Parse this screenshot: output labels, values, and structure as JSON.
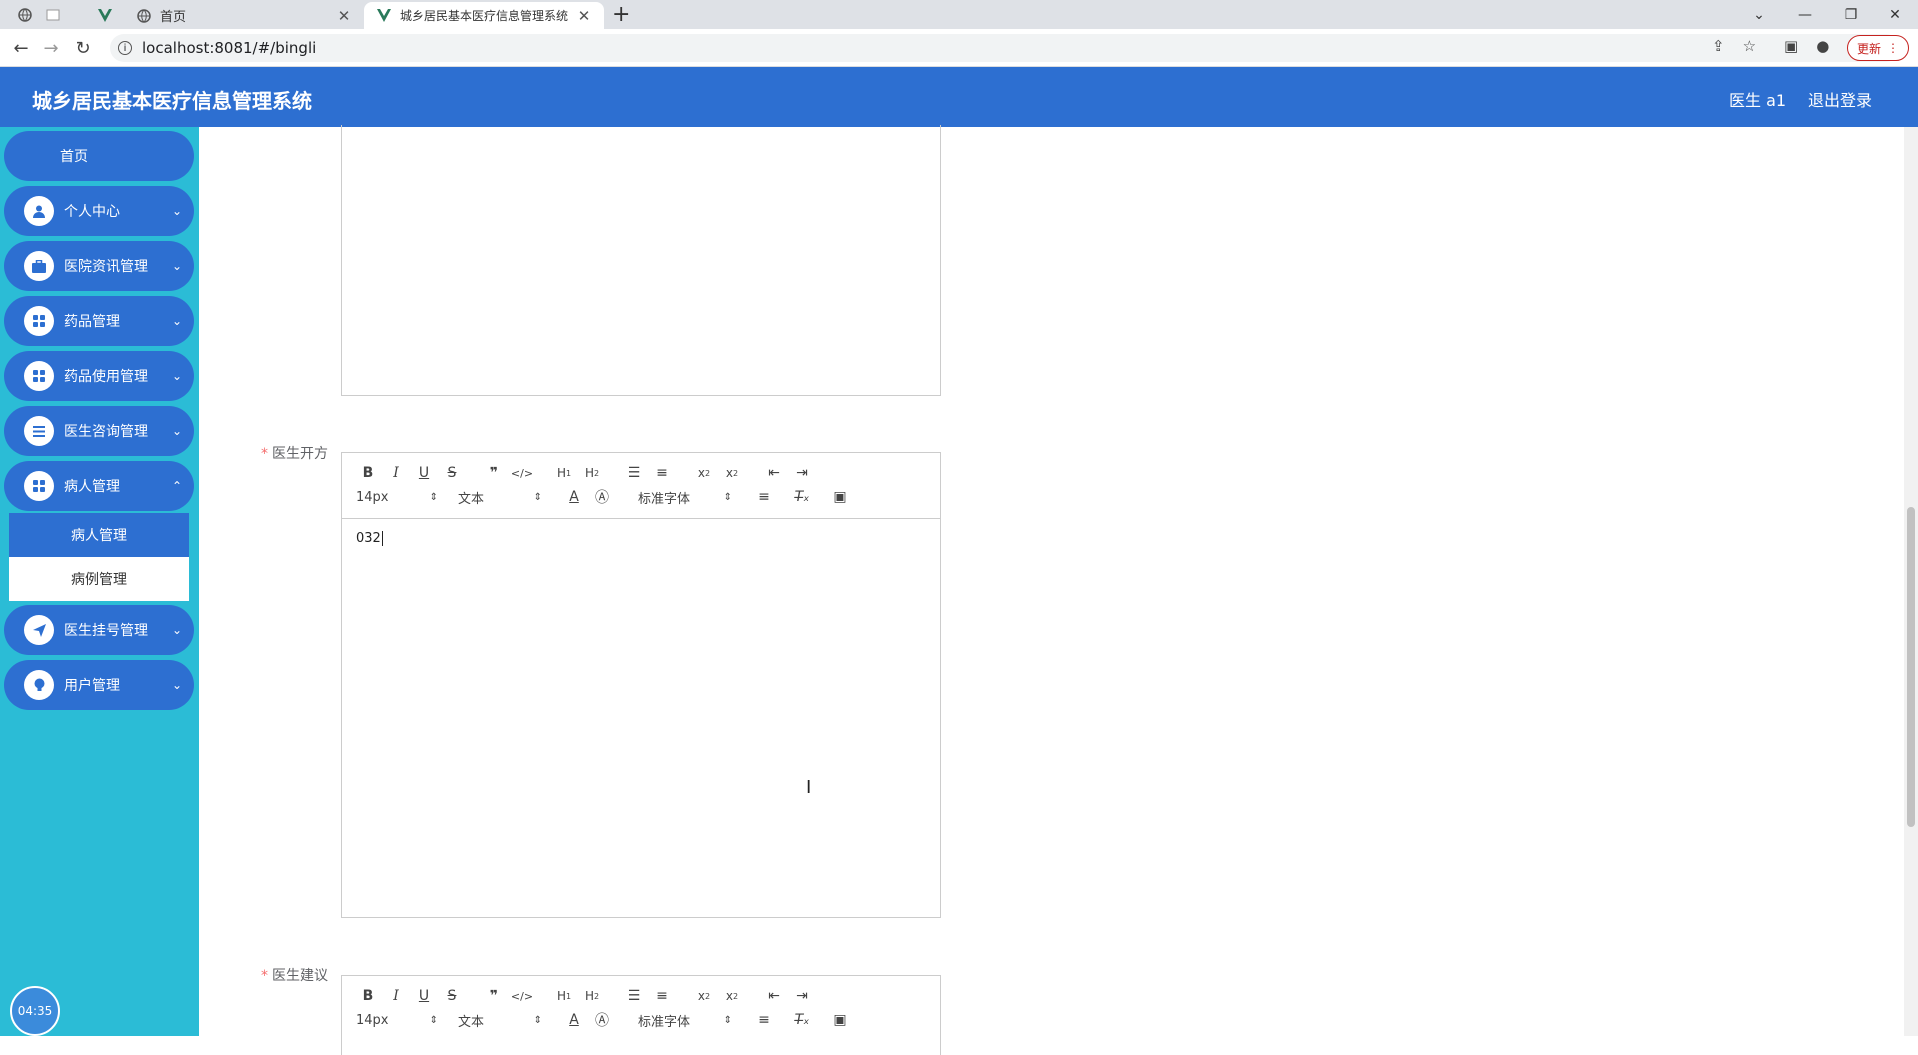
{
  "browser": {
    "tabs": [
      {
        "title": "首页",
        "active": false
      },
      {
        "title": "城乡居民基本医疗信息管理系统",
        "active": true
      }
    ],
    "url": "localhost:8081/#/bingli",
    "update_label": "更新"
  },
  "header": {
    "title": "城乡居民基本医疗信息管理系统",
    "user": "医生 a1",
    "logout": "退出登录"
  },
  "sidebar": {
    "home": "首页",
    "items": [
      {
        "label": "个人中心",
        "icon": "user-icon"
      },
      {
        "label": "医院资讯管理",
        "icon": "briefcase-icon"
      },
      {
        "label": "药品管理",
        "icon": "grid-icon"
      },
      {
        "label": "药品使用管理",
        "icon": "grid-icon"
      },
      {
        "label": "医生咨询管理",
        "icon": "list-icon"
      },
      {
        "label": "病人管理",
        "icon": "grid-icon"
      },
      {
        "label": "医生挂号管理",
        "icon": "send-icon"
      },
      {
        "label": "用户管理",
        "icon": "bulb-icon"
      }
    ],
    "submenu": [
      {
        "label": "病人管理",
        "active": true
      },
      {
        "label": "病例管理",
        "active": false
      }
    ],
    "clock": "04:35"
  },
  "form": {
    "prescription": {
      "label": "医生开方",
      "font_size": "14px",
      "header_type": "文本",
      "font_family": "标准字体",
      "content": "032"
    },
    "advice": {
      "label": "医生建议",
      "font_size": "14px",
      "header_type": "文本",
      "font_family": "标准字体"
    }
  },
  "colors": {
    "header": "#2d6fd1",
    "sidebar": "#2bbcd6",
    "required": "#f56c6c"
  }
}
